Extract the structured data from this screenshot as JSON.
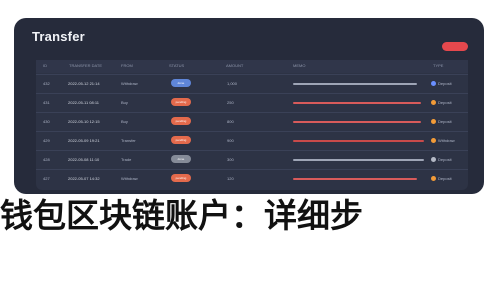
{
  "window": {
    "title": "Transfer"
  },
  "table": {
    "headers": {
      "id": "ID",
      "date": "TRANSFER DATE",
      "from": "FROM",
      "status": "STATUS",
      "amount": "AMOUNT",
      "memo": "MEMO",
      "type": "TYPE"
    },
    "rows": [
      {
        "id": "432",
        "date": "2022-05-12 21:14",
        "from": "Withdraw",
        "status": "done",
        "amount": "1,000",
        "type": "Deposit"
      },
      {
        "id": "431",
        "date": "2022-05-11 08:11",
        "from": "Buy",
        "status": "pending",
        "amount": "250",
        "type": "Deposit"
      },
      {
        "id": "430",
        "date": "2022-05-10 12:15",
        "from": "Buy",
        "status": "pending",
        "amount": "800",
        "type": "Deposit"
      },
      {
        "id": "429",
        "date": "2022-05-09 19:21",
        "from": "Transfer",
        "status": "pending",
        "amount": "900",
        "type": "Withdraw"
      },
      {
        "id": "428",
        "date": "2022-05-08 11:10",
        "from": "Trade",
        "status": "done",
        "amount": "300",
        "type": "Deposit"
      },
      {
        "id": "427",
        "date": "2022-05-07 14:32",
        "from": "Withdraw",
        "status": "pending",
        "amount": "120",
        "type": "Deposit"
      }
    ]
  },
  "caption": {
    "text": "钱包区块链账户：详细步"
  },
  "colors": {
    "panel": "#262b3b",
    "accent": "#e36a4c",
    "blue": "#5f86d9",
    "orange": "#f29b38"
  }
}
